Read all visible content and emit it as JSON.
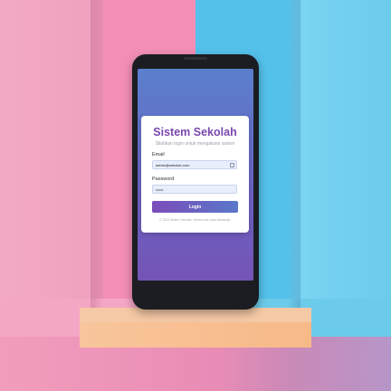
{
  "login_card": {
    "title": "Sistem Sekolah",
    "subtitle": "Silahkan login untuk mengakses sistem",
    "email_label": "Email",
    "email_value": "admin@sekolah.com",
    "password_label": "Password",
    "password_value": "••••••",
    "login_button": "Login",
    "footer": "© 2024 Sistem Sekolah. Semua hak cipta dilindungi."
  },
  "colors": {
    "accent_purple": "#7a47ad",
    "button_start": "#7b4dba",
    "button_end": "#5a78c9",
    "screen_top": "#5b7fcd",
    "screen_bottom": "#7454b6"
  },
  "icons": {
    "email_field_icon": "id-card-icon"
  }
}
